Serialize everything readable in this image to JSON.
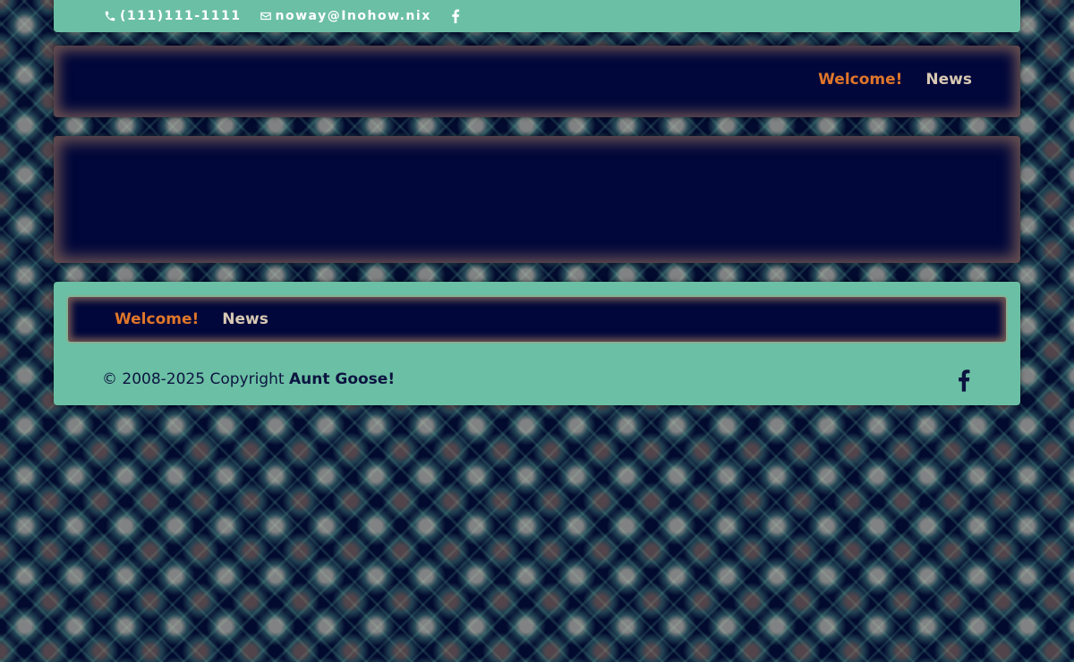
{
  "topbar": {
    "phone": "(111)111-1111",
    "email": "noway@Inohow.nix"
  },
  "header": {
    "nav": [
      {
        "label": "Welcome!",
        "active": true
      },
      {
        "label": "News",
        "active": false
      }
    ]
  },
  "footer": {
    "menu": [
      {
        "label": "Welcome!",
        "active": true
      },
      {
        "label": "News",
        "active": false
      }
    ],
    "copyright_text": "© 2008-2025 Copyright ",
    "copyright_brand": "Aunt Goose!"
  },
  "icons": {
    "phone": "phone-icon",
    "email": "envelope-icon",
    "social": "facebook-icon"
  },
  "colors": {
    "teal": "#6bbfa4",
    "navy": "#01073a",
    "active_link": "#e0762a",
    "link": "#d8c8b4",
    "footer_text": "#0c1440"
  }
}
